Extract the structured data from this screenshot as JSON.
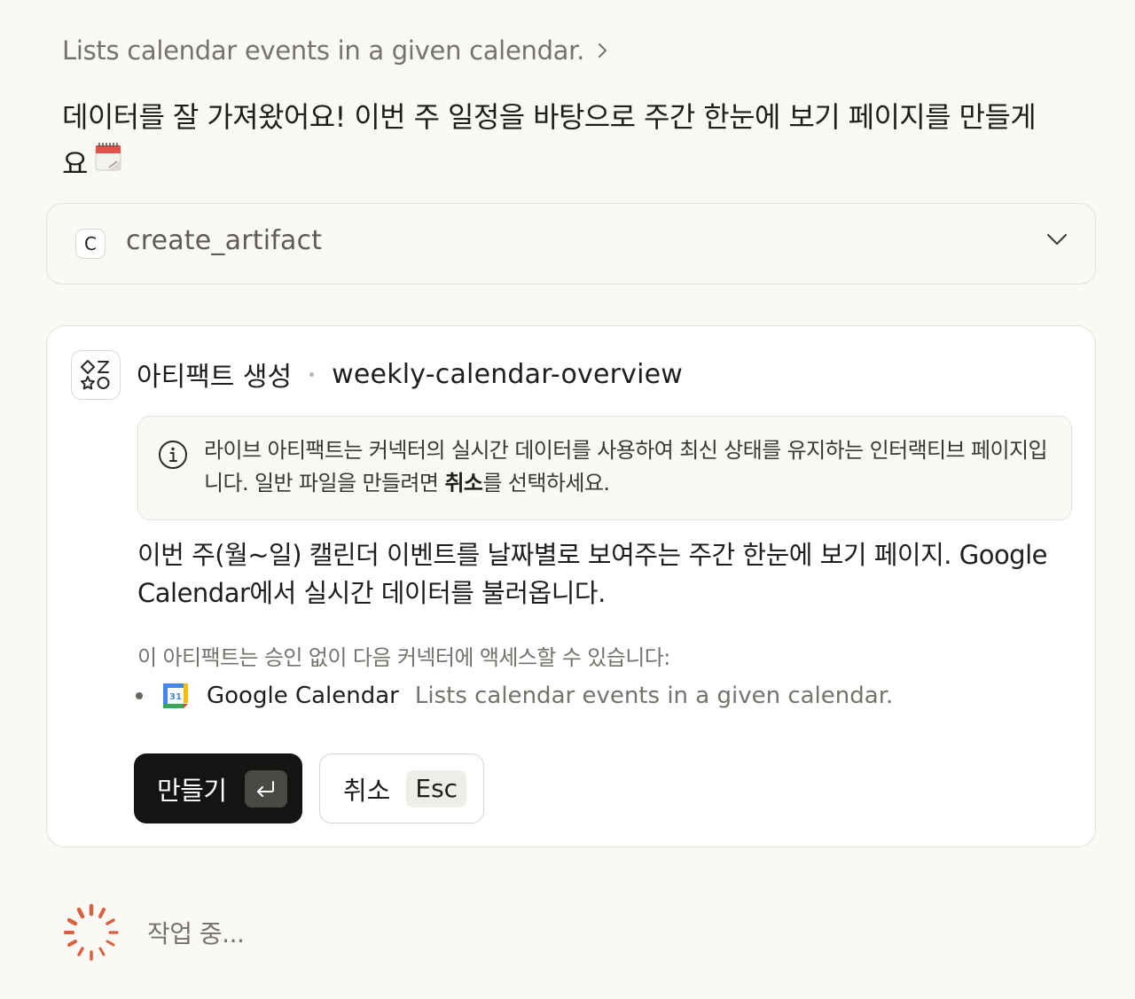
{
  "tool_link": {
    "label": "Lists calendar events in a given calendar."
  },
  "message": {
    "text": "데이터를 잘 가져왔어요! 이번 주 일정을 바탕으로 주간 한눈에 보기 페이지를 만들게요",
    "emoji_icon": "spiral-calendar-icon"
  },
  "tool_call": {
    "badge": "C",
    "name": "create_artifact"
  },
  "artifact": {
    "title": "아티팩트 생성",
    "slug": "weekly-calendar-overview",
    "info": {
      "text_before": "라이브 아티팩트는 커넥터의 실시간 데이터를 사용하여 최신 상태를 유지하는 인터랙티브 페이지입니다. 일반 파일을 만들려면 ",
      "bold": "취소",
      "text_after": "를 선택하세요."
    },
    "description": "이번 주(월~일) 캘린더 이벤트를 날짜별로 보여주는 주간 한눈에 보기 페이지. Google Calendar에서 실시간 데이터를 불러옵니다.",
    "access_note": "이 아티팩트는 승인 없이 다음 커넥터에 액세스할 수 있습니다:",
    "connectors": [
      {
        "name": "Google Calendar",
        "description": "Lists calendar events in a given calendar.",
        "icon_day": "31"
      }
    ],
    "buttons": {
      "create_label": "만들기",
      "cancel_label": "취소",
      "cancel_shortcut": "Esc"
    }
  },
  "status": {
    "text": "작업 중..."
  },
  "colors": {
    "background": "#faf9f6",
    "primary_button": "#141413",
    "spinner": "#d9603f"
  }
}
